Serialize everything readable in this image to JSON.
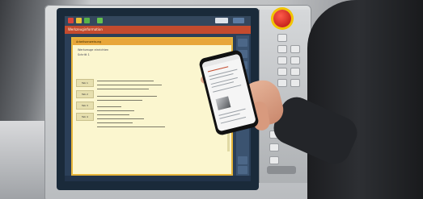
{
  "scene": {
    "description_label": "Operator holding smartphone next to industrial machine control screen"
  },
  "screen": {
    "titlebar_text": "Werkzeuginformation",
    "document_header": "Arbeitsanweisung",
    "document_subtitle_1": "Werkzeuge einrichten",
    "document_subtitle_2": "Schritt 1",
    "side_tabs": [
      "Tab 1",
      "Tab 2",
      "Tab 3",
      "Tab 4"
    ]
  },
  "colors": {
    "accent_title": "#c44b2e",
    "document_bg": "#fbf6cf",
    "document_border": "#e6b53a",
    "estop": "#d61c12"
  }
}
